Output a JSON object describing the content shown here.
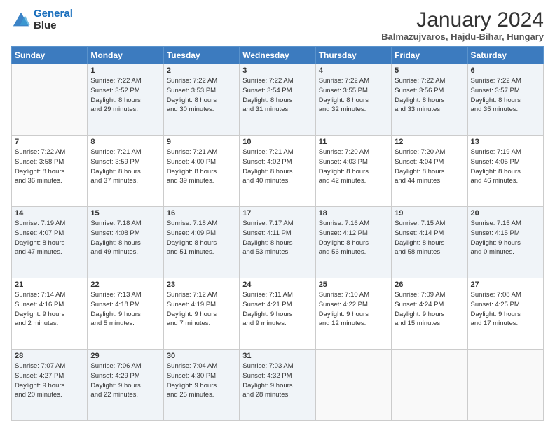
{
  "logo": {
    "line1": "General",
    "line2": "Blue"
  },
  "title": "January 2024",
  "location": "Balmazujvaros, Hajdu-Bihar, Hungary",
  "days_header": [
    "Sunday",
    "Monday",
    "Tuesday",
    "Wednesday",
    "Thursday",
    "Friday",
    "Saturday"
  ],
  "weeks": [
    [
      {
        "day": "",
        "sunrise": "",
        "sunset": "",
        "daylight": ""
      },
      {
        "day": "1",
        "sunrise": "7:22 AM",
        "sunset": "3:52 PM",
        "daylight": "8 hours and 29 minutes."
      },
      {
        "day": "2",
        "sunrise": "7:22 AM",
        "sunset": "3:53 PM",
        "daylight": "8 hours and 30 minutes."
      },
      {
        "day": "3",
        "sunrise": "7:22 AM",
        "sunset": "3:54 PM",
        "daylight": "8 hours and 31 minutes."
      },
      {
        "day": "4",
        "sunrise": "7:22 AM",
        "sunset": "3:55 PM",
        "daylight": "8 hours and 32 minutes."
      },
      {
        "day": "5",
        "sunrise": "7:22 AM",
        "sunset": "3:56 PM",
        "daylight": "8 hours and 33 minutes."
      },
      {
        "day": "6",
        "sunrise": "7:22 AM",
        "sunset": "3:57 PM",
        "daylight": "8 hours and 35 minutes."
      }
    ],
    [
      {
        "day": "7",
        "sunrise": "7:22 AM",
        "sunset": "3:58 PM",
        "daylight": "8 hours and 36 minutes."
      },
      {
        "day": "8",
        "sunrise": "7:21 AM",
        "sunset": "3:59 PM",
        "daylight": "8 hours and 37 minutes."
      },
      {
        "day": "9",
        "sunrise": "7:21 AM",
        "sunset": "4:00 PM",
        "daylight": "8 hours and 39 minutes."
      },
      {
        "day": "10",
        "sunrise": "7:21 AM",
        "sunset": "4:02 PM",
        "daylight": "8 hours and 40 minutes."
      },
      {
        "day": "11",
        "sunrise": "7:20 AM",
        "sunset": "4:03 PM",
        "daylight": "8 hours and 42 minutes."
      },
      {
        "day": "12",
        "sunrise": "7:20 AM",
        "sunset": "4:04 PM",
        "daylight": "8 hours and 44 minutes."
      },
      {
        "day": "13",
        "sunrise": "7:19 AM",
        "sunset": "4:05 PM",
        "daylight": "8 hours and 46 minutes."
      }
    ],
    [
      {
        "day": "14",
        "sunrise": "7:19 AM",
        "sunset": "4:07 PM",
        "daylight": "8 hours and 47 minutes."
      },
      {
        "day": "15",
        "sunrise": "7:18 AM",
        "sunset": "4:08 PM",
        "daylight": "8 hours and 49 minutes."
      },
      {
        "day": "16",
        "sunrise": "7:18 AM",
        "sunset": "4:09 PM",
        "daylight": "8 hours and 51 minutes."
      },
      {
        "day": "17",
        "sunrise": "7:17 AM",
        "sunset": "4:11 PM",
        "daylight": "8 hours and 53 minutes."
      },
      {
        "day": "18",
        "sunrise": "7:16 AM",
        "sunset": "4:12 PM",
        "daylight": "8 hours and 56 minutes."
      },
      {
        "day": "19",
        "sunrise": "7:15 AM",
        "sunset": "4:14 PM",
        "daylight": "8 hours and 58 minutes."
      },
      {
        "day": "20",
        "sunrise": "7:15 AM",
        "sunset": "4:15 PM",
        "daylight": "9 hours and 0 minutes."
      }
    ],
    [
      {
        "day": "21",
        "sunrise": "7:14 AM",
        "sunset": "4:16 PM",
        "daylight": "9 hours and 2 minutes."
      },
      {
        "day": "22",
        "sunrise": "7:13 AM",
        "sunset": "4:18 PM",
        "daylight": "9 hours and 5 minutes."
      },
      {
        "day": "23",
        "sunrise": "7:12 AM",
        "sunset": "4:19 PM",
        "daylight": "9 hours and 7 minutes."
      },
      {
        "day": "24",
        "sunrise": "7:11 AM",
        "sunset": "4:21 PM",
        "daylight": "9 hours and 9 minutes."
      },
      {
        "day": "25",
        "sunrise": "7:10 AM",
        "sunset": "4:22 PM",
        "daylight": "9 hours and 12 minutes."
      },
      {
        "day": "26",
        "sunrise": "7:09 AM",
        "sunset": "4:24 PM",
        "daylight": "9 hours and 15 minutes."
      },
      {
        "day": "27",
        "sunrise": "7:08 AM",
        "sunset": "4:25 PM",
        "daylight": "9 hours and 17 minutes."
      }
    ],
    [
      {
        "day": "28",
        "sunrise": "7:07 AM",
        "sunset": "4:27 PM",
        "daylight": "9 hours and 20 minutes."
      },
      {
        "day": "29",
        "sunrise": "7:06 AM",
        "sunset": "4:29 PM",
        "daylight": "9 hours and 22 minutes."
      },
      {
        "day": "30",
        "sunrise": "7:04 AM",
        "sunset": "4:30 PM",
        "daylight": "9 hours and 25 minutes."
      },
      {
        "day": "31",
        "sunrise": "7:03 AM",
        "sunset": "4:32 PM",
        "daylight": "9 hours and 28 minutes."
      },
      {
        "day": "",
        "sunrise": "",
        "sunset": "",
        "daylight": ""
      },
      {
        "day": "",
        "sunrise": "",
        "sunset": "",
        "daylight": ""
      },
      {
        "day": "",
        "sunrise": "",
        "sunset": "",
        "daylight": ""
      }
    ]
  ]
}
